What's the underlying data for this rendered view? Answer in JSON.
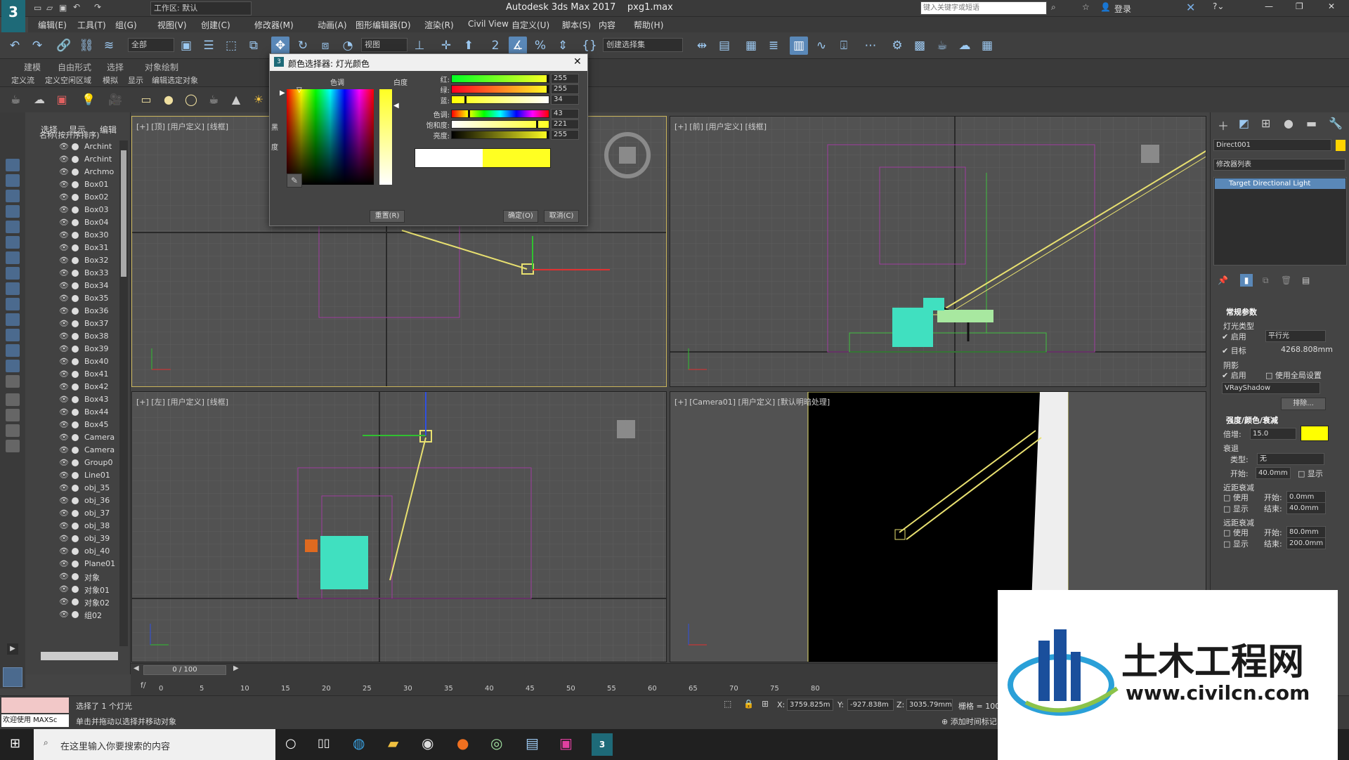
{
  "title": {
    "app": "Autodesk 3ds Max 2017",
    "file": "pxg1.max",
    "workspace": "工作区: 默认",
    "search_placeholder": "键入关键字或短语",
    "login": "登录"
  },
  "menus": [
    "编辑(E)",
    "工具(T)",
    "组(G)",
    "视图(V)",
    "创建(C)",
    "修改器(M)",
    "动画(A)",
    "图形编辑器(D)",
    "渲染(R)",
    "Civil View",
    "自定义(U)",
    "脚本(S)",
    "内容",
    "帮助(H)"
  ],
  "toolbar": {
    "filter": "全部",
    "refcoord": "视图",
    "selset": "创建选择集"
  },
  "ribbon": {
    "tabs": [
      "建模",
      "自由形式",
      "选择",
      "对象绘制"
    ],
    "sub": [
      "定义流",
      "定义空闲区域",
      "模拟",
      "显示",
      "编辑选定对象"
    ]
  },
  "explorer": {
    "tabs": [
      "选择",
      "显示",
      "编辑"
    ],
    "header": "名称(按升序排序)",
    "items": [
      "Archint",
      "Archint",
      "Archmo",
      "Box01",
      "Box02",
      "Box03",
      "Box04",
      "Box30",
      "Box31",
      "Box32",
      "Box33",
      "Box34",
      "Box35",
      "Box36",
      "Box37",
      "Box38",
      "Box39",
      "Box40",
      "Box41",
      "Box42",
      "Box43",
      "Box44",
      "Box45",
      "Camera",
      "Camera",
      "Group0",
      "Line01",
      "obj_35",
      "obj_36",
      "obj_37",
      "obj_38",
      "obj_39",
      "obj_40",
      "Plane01",
      "对象",
      "对象01",
      "对象02",
      "组02"
    ]
  },
  "viewports": {
    "top": "[+] [顶] [用户定义] [线框]",
    "front": "[+] [前] [用户定义] [线框]",
    "left": "[+] [左] [用户定义] [线框]",
    "camera": "[+] [Camera01] [用户定义] [默认明暗处理]"
  },
  "dialog": {
    "title": "颜色选择器: 灯光颜色",
    "hue_label": "色调",
    "white_label": "白度",
    "black_label": "黑",
    "deg_label": "度",
    "rows": [
      {
        "label": "红:",
        "value": "255",
        "pct": 1.0
      },
      {
        "label": "绿:",
        "value": "255",
        "pct": 1.0
      },
      {
        "label": "蓝:",
        "value": "34",
        "pct": 0.13
      },
      {
        "label": "色调:",
        "value": "43",
        "pct": 0.17
      },
      {
        "label": "饱和度:",
        "value": "221",
        "pct": 0.87
      },
      {
        "label": "亮度:",
        "value": "255",
        "pct": 1.0
      }
    ],
    "reset": "重置(R)",
    "ok": "确定(O)",
    "cancel": "取消(C)",
    "old_color": "#ffffff",
    "new_color": "#ffff22"
  },
  "command": {
    "object_name": "Direct001",
    "modifier_list": "修改器列表",
    "stack_item": "Target Directional Light",
    "general": "常规参数",
    "light_type": "灯光类型",
    "enable": "启用",
    "light_kind": "平行光",
    "target": "目标",
    "target_dist": "4268.808mm",
    "shadows": "阴影",
    "enable2": "启用",
    "global": "使用全局设置",
    "shadow_type": "VRayShadow",
    "exclude": "排除...",
    "intensity_hdr": "强度/颜色/衰减",
    "multiplier_label": "倍增:",
    "multiplier": "15.0",
    "decay": "衰退",
    "type_label": "类型:",
    "type_val": "无",
    "start_label": "开始:",
    "start_val": "40.0mm",
    "show": "显示",
    "near": "近距衰减",
    "use": "使用",
    "show2": "显示",
    "begin": "开始:",
    "near_start": "0.0mm",
    "end": "结束:",
    "near_end": "40.0mm",
    "far": "远距衰减",
    "use2": "使用",
    "far_start": "80.0mm",
    "show3": "显示",
    "far_end": "200.0mm",
    "light_color": "#ffff00"
  },
  "timeline": {
    "frame": "0 / 100",
    "ticks": [
      "0",
      "5",
      "10",
      "15",
      "20",
      "25",
      "30",
      "35",
      "40",
      "45",
      "50",
      "55",
      "60",
      "65",
      "70",
      "75",
      "80"
    ]
  },
  "status": {
    "selected": "选择了 1 个灯光",
    "hint": "单击并拖动以选择并移动对象",
    "welcome": "欢迎使用 MAXSc",
    "x_label": "X:",
    "x": "3759.825m",
    "y_label": "Y:",
    "y": "-927.838m",
    "z_label": "Z:",
    "z": "3035.79mm",
    "grid": "栅格 = 100.0",
    "add_tag": "添加时间标记"
  },
  "taskbar": {
    "search": "在这里输入你要搜索的内容"
  },
  "watermark": {
    "brand": "土木工程网",
    "url": "www.civilcn.com"
  }
}
